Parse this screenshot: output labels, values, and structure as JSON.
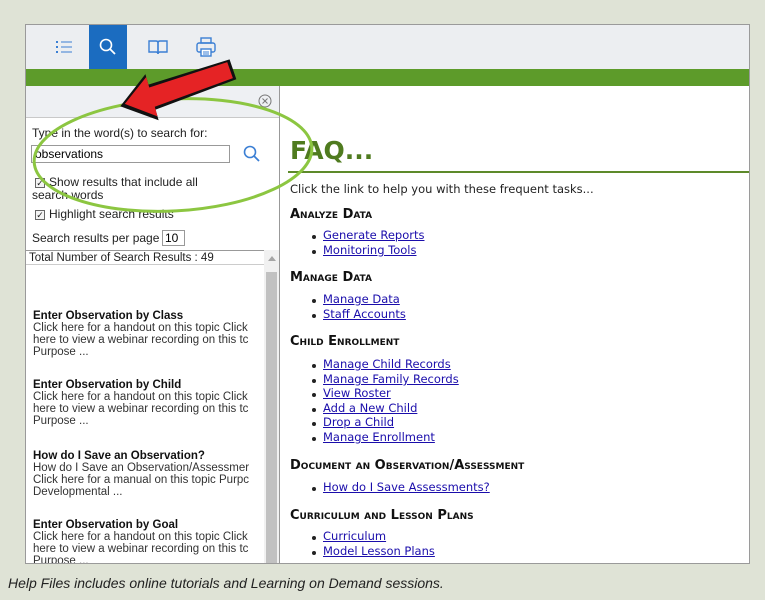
{
  "toolbar": {
    "buttons": [
      {
        "icon": "list-icon",
        "active": false
      },
      {
        "icon": "search-icon",
        "active": true
      },
      {
        "icon": "book-icon",
        "active": false
      },
      {
        "icon": "printer-icon",
        "active": false
      }
    ],
    "accent_color": "#1b6cc0",
    "bar_color": "#5d9b2a"
  },
  "search_panel": {
    "prompt": "Type in the word(s) to search for:",
    "query": "observations",
    "option_all_words": "Show results that include all search words",
    "option_all_words_line1": "Show results that include all",
    "option_all_words_line2": "search words",
    "option_highlight": "Highlight search results",
    "per_page_label": "Search results per page",
    "per_page_value": "10",
    "total_label": "Total Number of Search Results : 49",
    "results": [
      {
        "title": "Enter Observation by Class",
        "lines": [
          "Click here for a handout on this topic Click",
          "here to view a webinar recording on this tc",
          "Purpose ..."
        ]
      },
      {
        "title": "Enter Observation by Child",
        "lines": [
          "Click here for a handout on this topic Click",
          "here to view a webinar recording on this tc",
          "Purpose ..."
        ]
      },
      {
        "title": "How do I Save an Observation?",
        "lines": [
          "How do I Save an Observation/Assessmer",
          "Click here for a manual on this topic Purpc",
          "Developmental ..."
        ]
      },
      {
        "title": "Enter Observation by Goal",
        "lines": [
          "Click here for a handout on this topic Click",
          "here to view a webinar recording on this tc",
          "Purpose ..."
        ]
      }
    ]
  },
  "content": {
    "title": "FAQ...",
    "title_color": "#4f7b1f",
    "intro": "Click the link to help you with these frequent tasks...",
    "sections": [
      {
        "heading": "Analyze Data",
        "links": [
          "Generate Reports",
          "Monitoring Tools"
        ]
      },
      {
        "heading": "Manage Data",
        "links": [
          "Manage Data",
          "Staff Accounts"
        ]
      },
      {
        "heading": "Child Enrollment",
        "links": [
          "Manage Child Records",
          "Manage Family Records",
          "View Roster",
          "Add a New Child",
          "Drop a Child",
          "Manage Enrollment"
        ]
      },
      {
        "heading": "Document an Observation/Assessment",
        "links": [
          "How do I Save Assessments?"
        ]
      },
      {
        "heading": "Curriculum and Lesson Plans",
        "links": [
          "Curriculum",
          "Model Lesson Plans"
        ]
      }
    ]
  },
  "caption": "Help Files includes online tutorials and Learning on Demand sessions."
}
